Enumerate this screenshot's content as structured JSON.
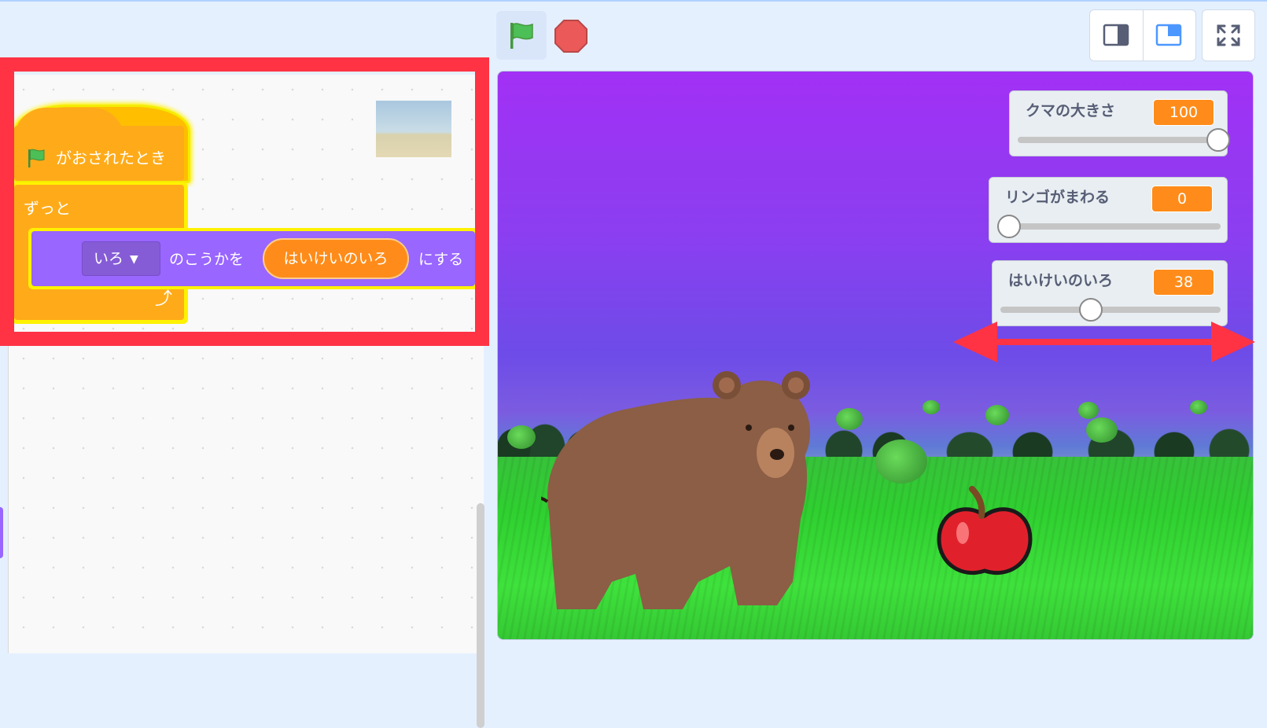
{
  "toolbar": {
    "green_flag_icon": "green-flag-icon",
    "stop_icon": "stop-sign-icon",
    "stage_layout_small_icon": "small-stage-icon",
    "stage_layout_normal_icon": "normal-stage-icon",
    "fullscreen_icon": "fullscreen-icon"
  },
  "script": {
    "hat_label": "がおされたとき",
    "forever_label": "ずっと",
    "effect_dropdown": "いろ",
    "looks_text_mid": "のこうかを",
    "reporter_label": "はいけいのいろ",
    "looks_text_end": "にする",
    "loop_arrow": "⤴"
  },
  "monitors": [
    {
      "label": "クマの大きさ",
      "value": "100",
      "slider_fraction": 1.0
    },
    {
      "label": "リンゴがまわる",
      "value": "0",
      "slider_fraction": 0.0
    },
    {
      "label": "はいけいのいろ",
      "value": "38",
      "slider_fraction": 0.38
    }
  ],
  "colors": {
    "events": "#ffab19",
    "looks": "#9966ff",
    "reporter": "#ff8c1a",
    "highlight": "#ff3344",
    "glow": "#fff200"
  }
}
